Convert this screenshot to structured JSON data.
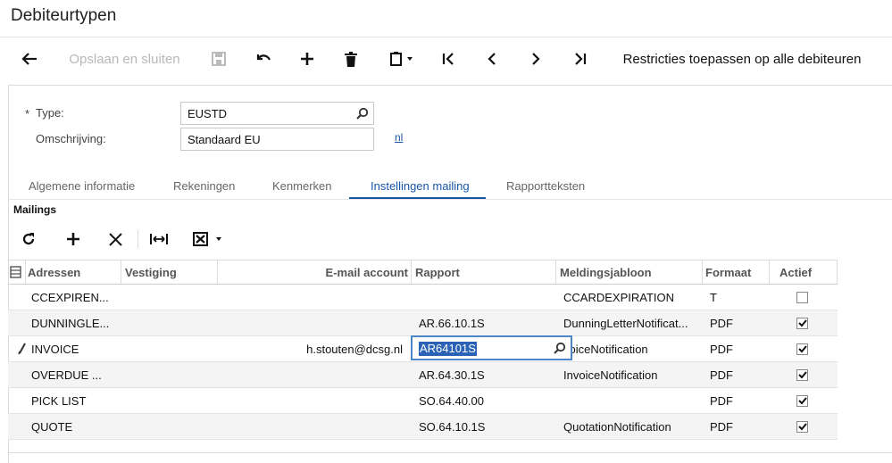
{
  "page": {
    "title": "Debiteurtypen"
  },
  "toolbar": {
    "save_close_label": "Opslaan en sluiten",
    "restrict_label": "Restricties toepassen op alle debiteuren"
  },
  "form": {
    "type_required_mark": "*",
    "type_label": "Type:",
    "type_value": "EUSTD",
    "description_label": "Omschrijving:",
    "description_value": "Standaard EU",
    "language_link": "nl"
  },
  "tabs": [
    {
      "label": "Algemene informatie"
    },
    {
      "label": "Rekeningen"
    },
    {
      "label": "Kenmerken"
    },
    {
      "label": "Instellingen mailing"
    },
    {
      "label": "Rapportteksten"
    }
  ],
  "active_tab": "Instellingen mailing",
  "section": {
    "title": "Mailings"
  },
  "grid": {
    "columns": [
      "Adressen",
      "Vestiging",
      "E-mail account",
      "Rapport",
      "Meldingsjabloon",
      "Formaat",
      "Actief"
    ],
    "rows": [
      {
        "adressen": "CCEXPIREN...",
        "vestiging": "",
        "email": "",
        "rapport": "",
        "jabloon": "CCARDEXPIRATION",
        "formaat": "T",
        "actief": false
      },
      {
        "adressen": "DUNNINGLE...",
        "vestiging": "",
        "email": "",
        "rapport": "AR.66.10.1S",
        "jabloon": "DunningLetterNotificat...",
        "formaat": "PDF",
        "actief": true
      },
      {
        "adressen": "INVOICE",
        "vestiging": "",
        "email": "h.stouten@dcsg.nl",
        "rapport": "AR64101S",
        "jabloon": "voiceNotification",
        "formaat": "PDF",
        "actief": true
      },
      {
        "adressen": "OVERDUE ...",
        "vestiging": "",
        "email": "",
        "rapport": "AR.64.30.1S",
        "jabloon": "InvoiceNotification",
        "formaat": "PDF",
        "actief": true
      },
      {
        "adressen": "PICK LIST",
        "vestiging": "",
        "email": "",
        "rapport": "SO.64.40.00",
        "jabloon": "",
        "formaat": "PDF",
        "actief": true
      },
      {
        "adressen": "QUOTE",
        "vestiging": "",
        "email": "",
        "rapport": "SO.64.10.1S",
        "jabloon": "QuotationNotification",
        "formaat": "PDF",
        "actief": true
      }
    ],
    "editing_value": "AR64101S"
  },
  "colors": {
    "accent": "#1a56a8",
    "selection": "#2a63b5",
    "edit_border": "#4a86c9",
    "alt_row": "#f4f4f4"
  },
  "icons": {
    "back": "arrow-left-icon",
    "save": "floppy-icon",
    "undo": "undo-icon",
    "add": "plus-icon",
    "delete": "trash-icon",
    "clipboard": "clipboard-icon",
    "first": "first-icon",
    "prev": "prev-icon",
    "next": "next-icon",
    "last": "last-icon",
    "refresh": "refresh-icon",
    "close": "close-icon",
    "fit": "fit-columns-icon",
    "excel": "excel-icon",
    "search": "search-icon",
    "edit": "pencil-icon",
    "settings": "grid-settings-icon"
  }
}
